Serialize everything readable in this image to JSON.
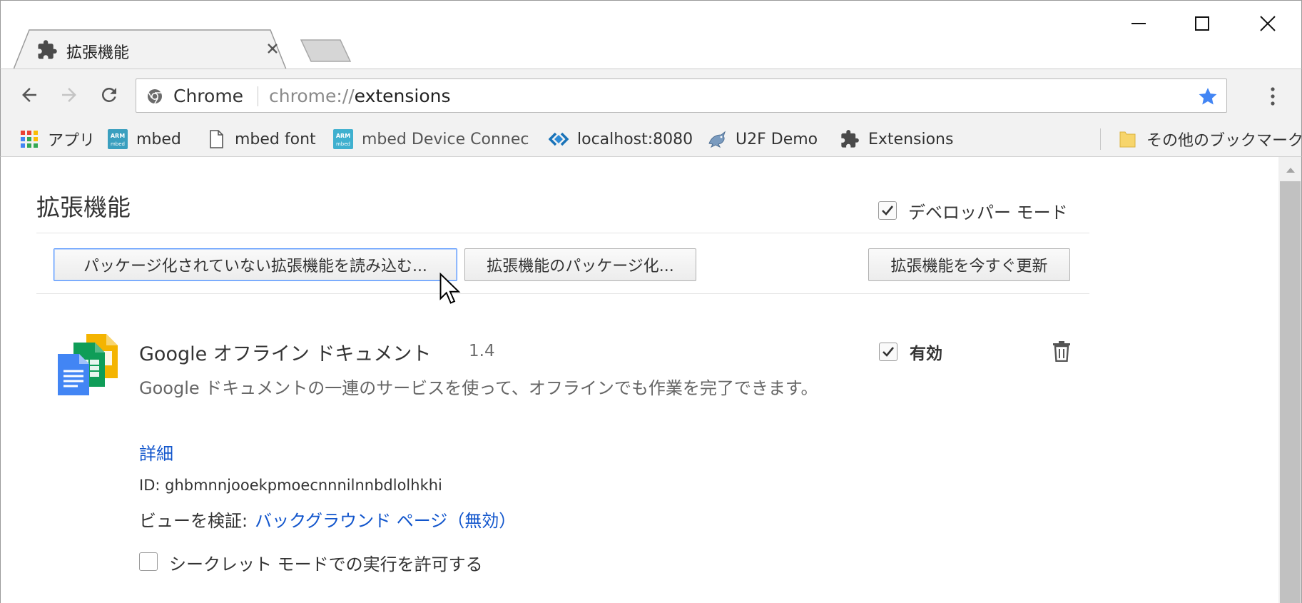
{
  "window": {
    "tab_title": "拡張機能",
    "tab_close_glyph": "✕",
    "minimize_glyph": "—",
    "close_glyph": "✕"
  },
  "toolbar": {
    "omnibox_chip": "Chrome",
    "url_scheme": "chrome://",
    "url_host": "extensions",
    "star_color": "#4285f4"
  },
  "bookmarks": {
    "items": [
      {
        "label": "アプリ",
        "icon": "apps-grid-icon"
      },
      {
        "label": "mbed",
        "icon": "arm-mbed-icon"
      },
      {
        "label": "mbed font",
        "icon": "page-icon"
      },
      {
        "label": "mbed Device Connec",
        "icon": "arm-mbed-icon"
      },
      {
        "label": "localhost:8080",
        "icon": "diamond-arrows-icon"
      },
      {
        "label": "U2F Demo",
        "icon": "dragon-icon"
      },
      {
        "label": "Extensions",
        "icon": "puzzle-icon"
      }
    ],
    "other_label": "その他のブックマーク"
  },
  "page": {
    "title": "拡張機能",
    "developer_mode_label": "デベロッパー モード",
    "developer_mode_checked": true,
    "load_unpacked_label": "パッケージ化されていない拡張機能を読み込む...",
    "pack_label": "拡張機能のパッケージ化...",
    "update_label": "拡張機能を今すぐ更新"
  },
  "extension": {
    "name": "Google オフライン ドキュメント",
    "version": "1.4",
    "description": "Google ドキュメントの一連のサービスを使って、オフラインでも作業を完了できます。",
    "details_link": "詳細",
    "id_text": "ID: ghbmnnjooekpmoecnnnilnnbdlolhkhi",
    "inspect_views_label": "ビューを検証:",
    "background_page_link": "バックグラウンド ページ（無効）",
    "incognito_label": "シークレット モードでの実行を許可する",
    "incognito_checked": false,
    "enabled_label": "有効",
    "enabled_checked": true
  },
  "colors": {
    "link": "#1155cc",
    "focus_ring": "#4d90fe"
  }
}
